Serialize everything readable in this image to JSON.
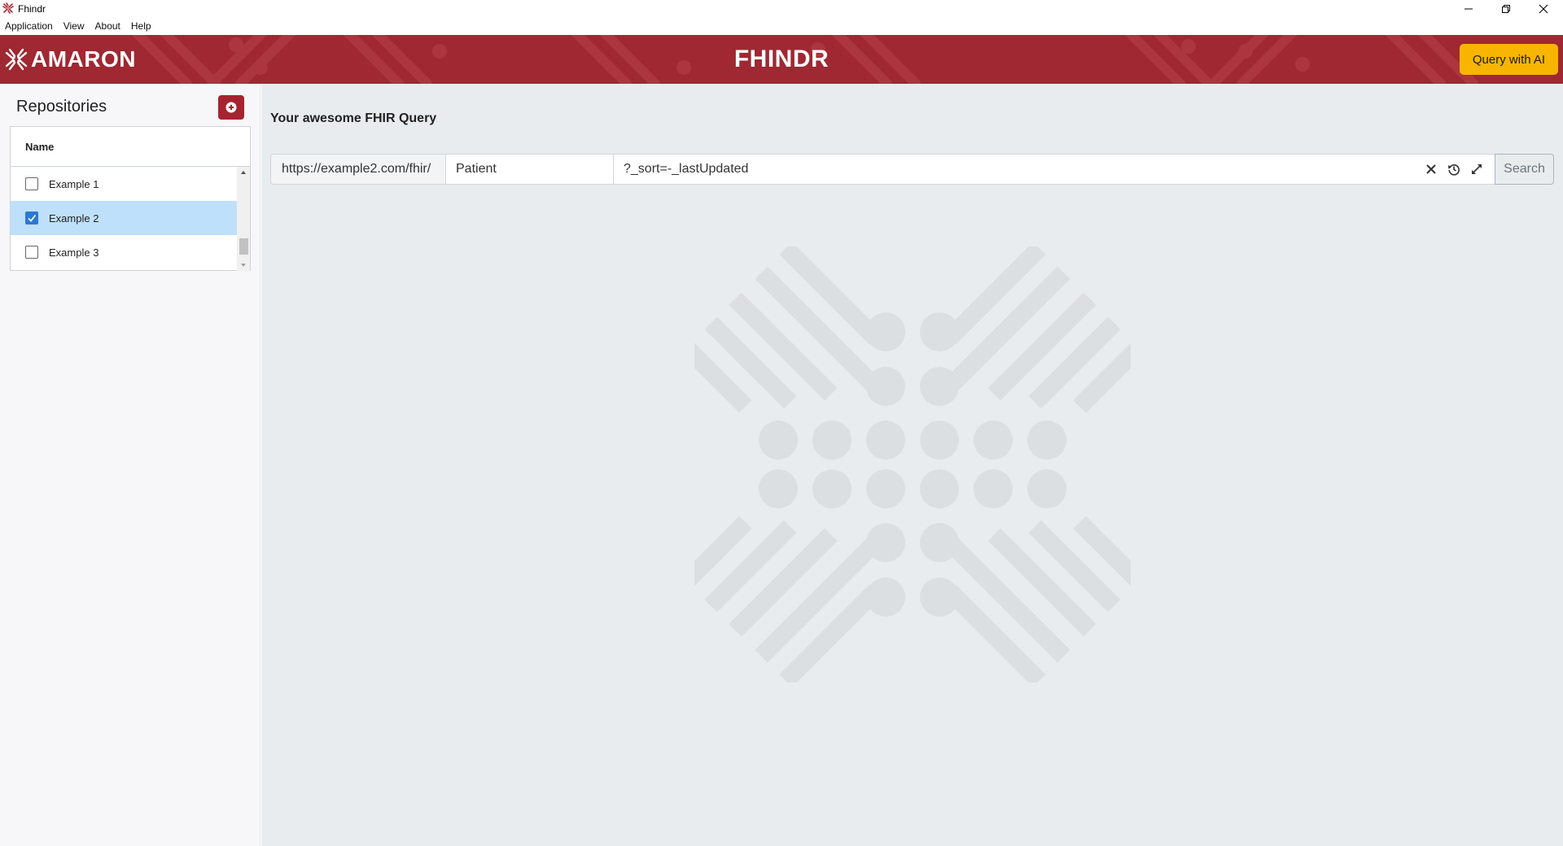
{
  "window": {
    "title": "Fhindr",
    "controls": [
      "minimize-icon",
      "restore-icon",
      "close-icon"
    ]
  },
  "menu": {
    "items": [
      "Application",
      "View",
      "About",
      "Help"
    ]
  },
  "header": {
    "brand": "AMARON",
    "title": "FHINDR",
    "ai_button_label": "Query with AI",
    "colors": {
      "banner": "#9f2832",
      "ai_button": "#f7b500"
    }
  },
  "sidebar": {
    "title": "Repositories",
    "add_icon": "plus-circle-icon",
    "column_header": "Name",
    "repositories": [
      {
        "name": "Example 1",
        "checked": false,
        "selected": false
      },
      {
        "name": "Example 2",
        "checked": true,
        "selected": true
      },
      {
        "name": "Example 3",
        "checked": false,
        "selected": false
      }
    ]
  },
  "query": {
    "title": "Your awesome FHIR Query",
    "base_url": "https://example2.com/fhir/",
    "resource": "Patient",
    "params": "?_sort=-_lastUpdated",
    "tools": [
      "clear-icon",
      "history-icon",
      "expand-icon"
    ],
    "search_label": "Search"
  }
}
